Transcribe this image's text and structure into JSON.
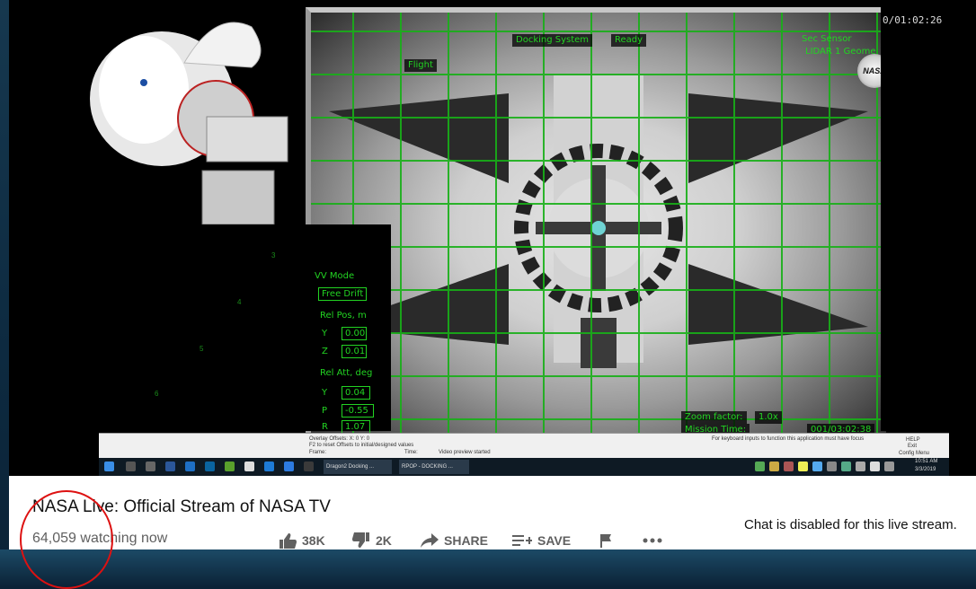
{
  "video": {
    "docking_hud": {
      "top_left_label": "Flight",
      "docking_system_label": "Docking System",
      "ready_label": "Ready",
      "sec_sensor_label": "Sec Sensor",
      "lidar_label": "LIDAR 1 Geome",
      "zoom_label": "Zoom factor:",
      "zoom_value": "1.0x",
      "mission_time_label": "Mission Time:",
      "mission_time_value": "001/03:02:38"
    },
    "left_panel": {
      "vv_mode_label": "VV Mode",
      "free_drift_label": "Free Drift",
      "rel_pos_label": "Rel Pos, m",
      "y_label": "Y",
      "y_value": "0.00",
      "z_label": "Z",
      "z_value": "0.01",
      "rel_att_label": "Rel Att, deg",
      "att_y_label": "Y",
      "att_y_value": "0.04",
      "p_label": "P",
      "p_value": "-0.55",
      "r_label": "R",
      "r_value": "1.07"
    },
    "star_numbers": [
      "3",
      "4",
      "5",
      "6"
    ],
    "stream_timer": "0/01:02:26",
    "nasa_logo_text": "NASA",
    "app_footer": {
      "overlay_text": "Overlay Offsets: X: 0  Y: 0",
      "reset_text": "F2 to reset Offsets to initial/designed values",
      "frame_text": "Frame:",
      "time_text": "Time:",
      "video_status": "Video preview started",
      "keyboard_note": "For keyboard inputs to function this application must have focus",
      "help_label": "HELP",
      "exit_label": "Exit",
      "config_label": "Config Menu"
    },
    "taskbar": {
      "app1": "Dragon2 Docking ...",
      "app2": "RPOP - DOCKING ...",
      "clock_time": "10:51 AM",
      "clock_date": "3/3/2019"
    }
  },
  "info": {
    "title": "NASA Live: Official Stream of NASA TV",
    "views": "64,059 watching now",
    "like_count": "38K",
    "dislike_count": "2K",
    "share_label": "SHARE",
    "save_label": "SAVE",
    "chat_disabled": "Chat is disabled for this live stream.",
    "icons": [
      "thumbs-up-icon",
      "thumbs-down-icon",
      "share-icon",
      "save-playlist-icon",
      "flag-icon",
      "more-icon"
    ]
  },
  "colors": {
    "hud_green": "#22d322",
    "annotation_red": "#d11111",
    "text_gray": "#606060"
  }
}
